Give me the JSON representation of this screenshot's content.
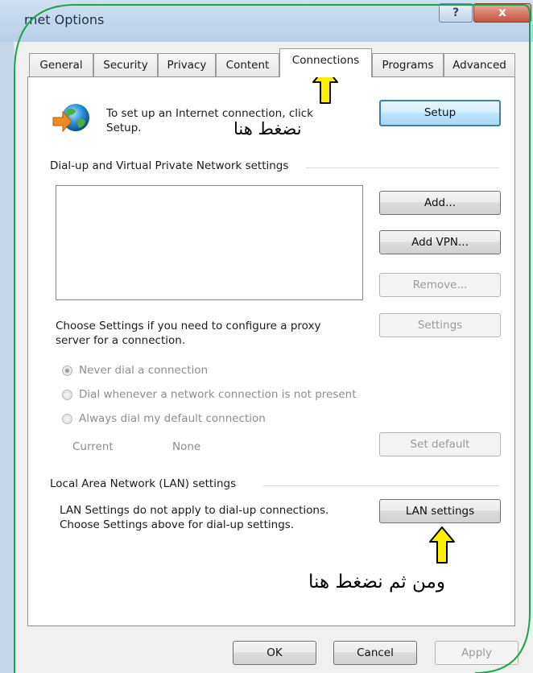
{
  "window": {
    "title": "rnet Options",
    "help_glyph": "?",
    "close_glyph": "x"
  },
  "tabs": [
    {
      "label": "General"
    },
    {
      "label": "Security"
    },
    {
      "label": "Privacy"
    },
    {
      "label": "Content"
    },
    {
      "label": "Connections",
      "active": true
    },
    {
      "label": "Programs"
    },
    {
      "label": "Advanced"
    }
  ],
  "setup_section": {
    "text_line1": "To set up an Internet connection, click",
    "text_line2": "Setup.",
    "setup_button": "Setup",
    "annotation": "نضغط هنا"
  },
  "dialup_section": {
    "heading": "Dial-up and Virtual Private Network settings",
    "add_button": "Add...",
    "add_vpn_button": "Add VPN...",
    "remove_button": "Remove...",
    "proxy_text_line1": "Choose Settings if you need to configure a proxy",
    "proxy_text_line2": "server for a connection.",
    "settings_button": "Settings",
    "radio_options": [
      {
        "label": "Never dial a connection",
        "selected": true
      },
      {
        "label": "Dial whenever a network connection is not present",
        "selected": false
      },
      {
        "label": "Always dial my default connection",
        "selected": false
      }
    ],
    "current_label": "Current",
    "current_value": "None",
    "set_default_button": "Set default"
  },
  "lan_section": {
    "heading": "Local Area Network (LAN) settings",
    "text_line1": "LAN Settings do not apply to dial-up connections.",
    "text_line2": "Choose Settings above for dial-up settings.",
    "lan_button": "LAN settings",
    "annotation": "ومن ثم نضغط هنا"
  },
  "footer": {
    "ok": "OK",
    "cancel": "Cancel",
    "apply": "Apply"
  },
  "colors": {
    "annotation_arrow": "#ffef00",
    "annotation_border": "#1aa54a",
    "dialog_bg": "#f0f0f0",
    "default_button_border": "#3c7fb1"
  }
}
